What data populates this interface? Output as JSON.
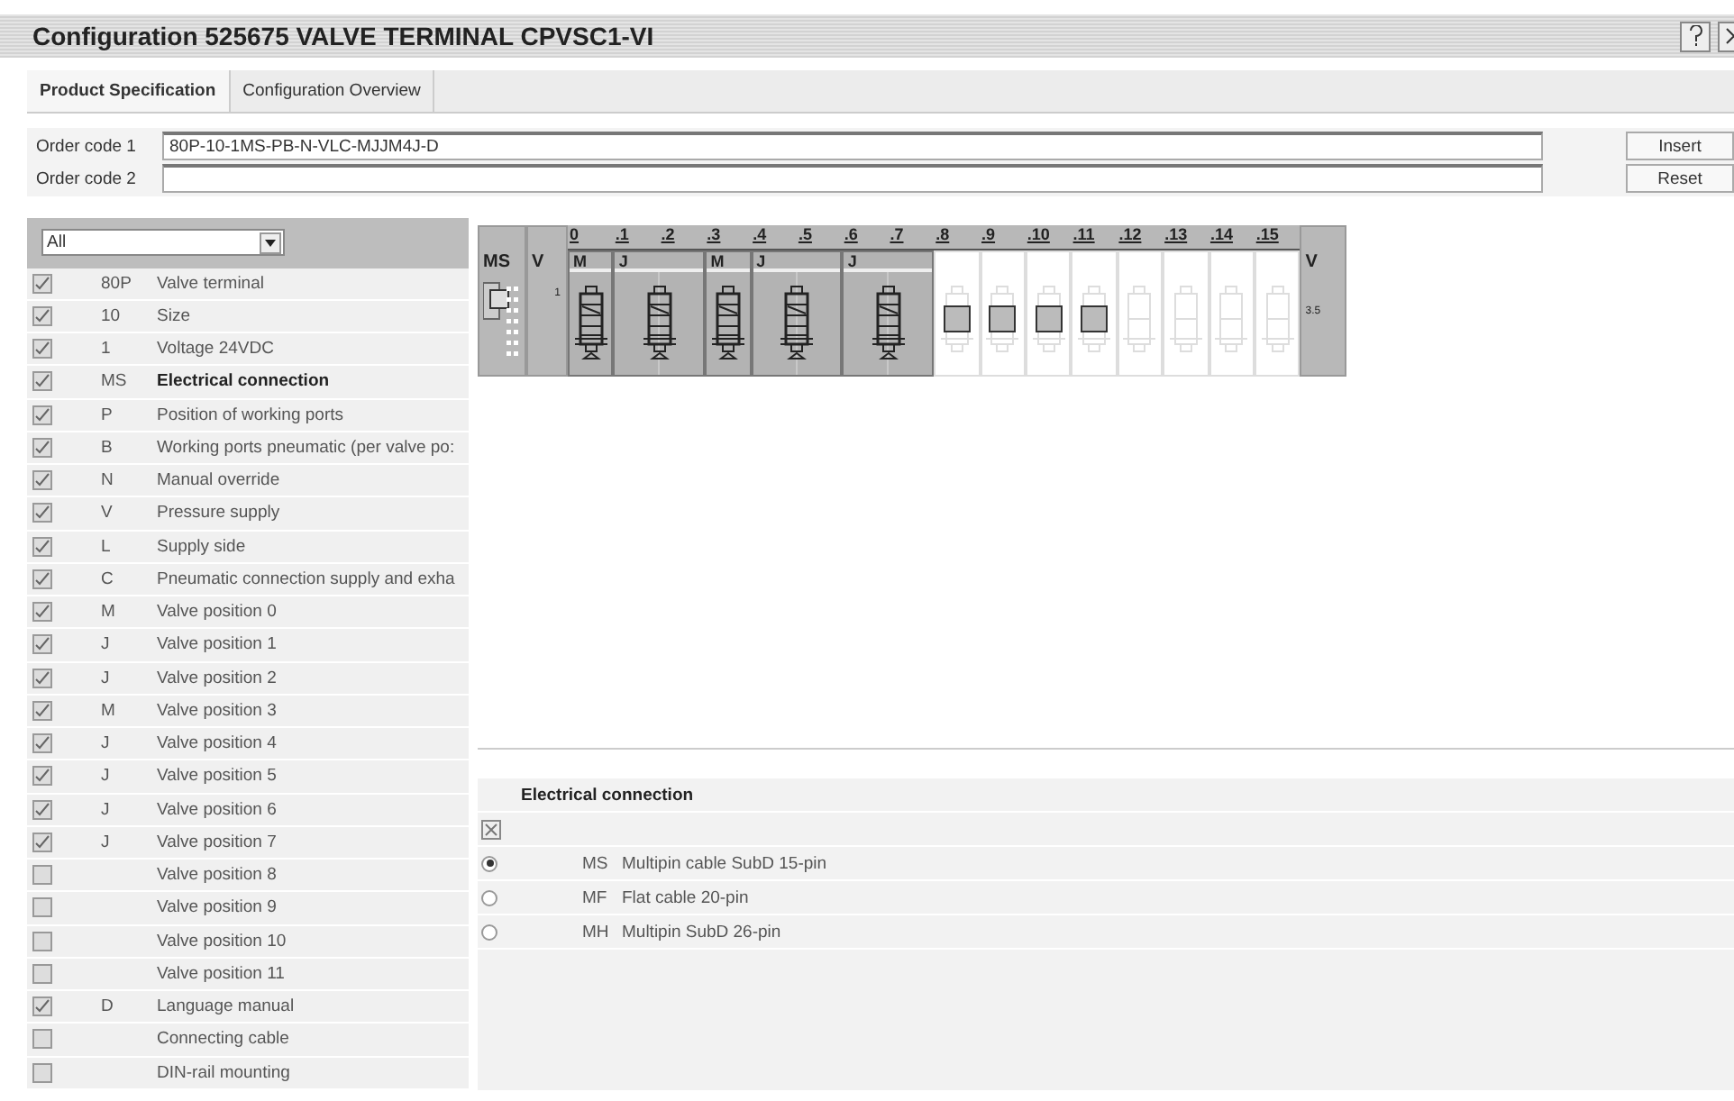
{
  "window": {
    "title": "Configuration 525675 VALVE TERMINAL CPVSC1-VI"
  },
  "tabs": [
    {
      "label": "Product Specification",
      "selected": true
    },
    {
      "label": "Configuration Overview",
      "selected": false
    }
  ],
  "order_codes": [
    {
      "label": "Order code 1",
      "value": "80P-10-1MS-PB-N-VLC-MJJM4J-D"
    },
    {
      "label": "Order code 2"
    }
  ],
  "buttons": [
    "Insert",
    "Reset"
  ],
  "filter": {
    "value": "All"
  },
  "features": [
    {
      "code": "80P",
      "label": "Valve terminal",
      "checked": true,
      "selected": false
    },
    {
      "code": "10",
      "label": "Size",
      "checked": true,
      "selected": false
    },
    {
      "code": "1",
      "label": "Voltage 24VDC",
      "checked": true,
      "selected": false
    },
    {
      "code": "MS",
      "label": "Electrical connection",
      "checked": true,
      "selected": true
    },
    {
      "code": "P",
      "label": "Position of working ports",
      "checked": true,
      "selected": false
    },
    {
      "code": "B",
      "label": "Working ports pneumatic (per valve po:",
      "checked": true,
      "selected": false
    },
    {
      "code": "N",
      "label": "Manual override",
      "checked": true,
      "selected": false
    },
    {
      "code": "V",
      "label": "Pressure supply",
      "checked": true,
      "selected": false
    },
    {
      "code": "L",
      "label": "Supply side",
      "checked": true,
      "selected": false
    },
    {
      "code": "C",
      "label": "Pneumatic connection supply and exha",
      "checked": true,
      "selected": false
    },
    {
      "code": "M",
      "label": "Valve position 0",
      "checked": true,
      "selected": false
    },
    {
      "code": "J",
      "label": "Valve position 1",
      "checked": true,
      "selected": false
    },
    {
      "code": "J",
      "label": "Valve position 2",
      "checked": true,
      "selected": false
    },
    {
      "code": "M",
      "label": "Valve position 3",
      "checked": true,
      "selected": false
    },
    {
      "code": "J",
      "label": "Valve position 4",
      "checked": true,
      "selected": false
    },
    {
      "code": "J",
      "label": "Valve position 5",
      "checked": true,
      "selected": false
    },
    {
      "code": "J",
      "label": "Valve position 6",
      "checked": true,
      "selected": false
    },
    {
      "code": "J",
      "label": "Valve position 7",
      "checked": true,
      "selected": false
    },
    {
      "label": "Valve position 8",
      "checked": false,
      "selected": false
    },
    {
      "label": "Valve position 9",
      "checked": false,
      "selected": false
    },
    {
      "label": "Valve position 10",
      "checked": false,
      "selected": false
    },
    {
      "label": "Valve position 11",
      "checked": false,
      "selected": false
    },
    {
      "code": "D",
      "label": "Language manual",
      "checked": true,
      "selected": false
    },
    {
      "label": "Connecting cable",
      "checked": false,
      "selected": false
    },
    {
      "label": "DIN-rail mounting",
      "checked": false,
      "selected": false
    }
  ],
  "terminal": {
    "left_modules": [
      {
        "label": "MS",
        "kind": "connector"
      },
      {
        "label": "V",
        "kind": "supply",
        "mark": "1"
      }
    ],
    "slot_numbers": [
      "0",
      ".1",
      ".2",
      ".3",
      ".4",
      ".5",
      ".6",
      ".7",
      ".8",
      ".9",
      ".10",
      ".11",
      ".12",
      ".13",
      ".14",
      ".15"
    ],
    "groups": [
      {
        "code": "M",
        "kind": "valve"
      },
      {
        "code": "J",
        "kind": "pair"
      },
      {
        "code": "M",
        "kind": "valve"
      },
      {
        "code": "J",
        "kind": "pair"
      },
      {
        "code": "J",
        "kind": "pair"
      },
      {
        "kind": "reserved"
      },
      {
        "kind": "reserved"
      },
      {
        "kind": "reserved"
      },
      {
        "kind": "reserved"
      },
      {
        "kind": "empty"
      },
      {
        "kind": "empty"
      },
      {
        "kind": "empty"
      },
      {
        "kind": "empty"
      }
    ],
    "right_module": {
      "label": "V",
      "mark": "3.5"
    }
  },
  "options_panel": {
    "title": "Electrical connection",
    "options": [
      {
        "code": "MS",
        "label": "Multipin cable SubD 15-pin",
        "selected": true
      },
      {
        "code": "MF",
        "label": "Flat cable 20-pin",
        "selected": false
      },
      {
        "code": "MH",
        "label": "Multipin SubD 26-pin",
        "selected": false
      }
    ]
  }
}
